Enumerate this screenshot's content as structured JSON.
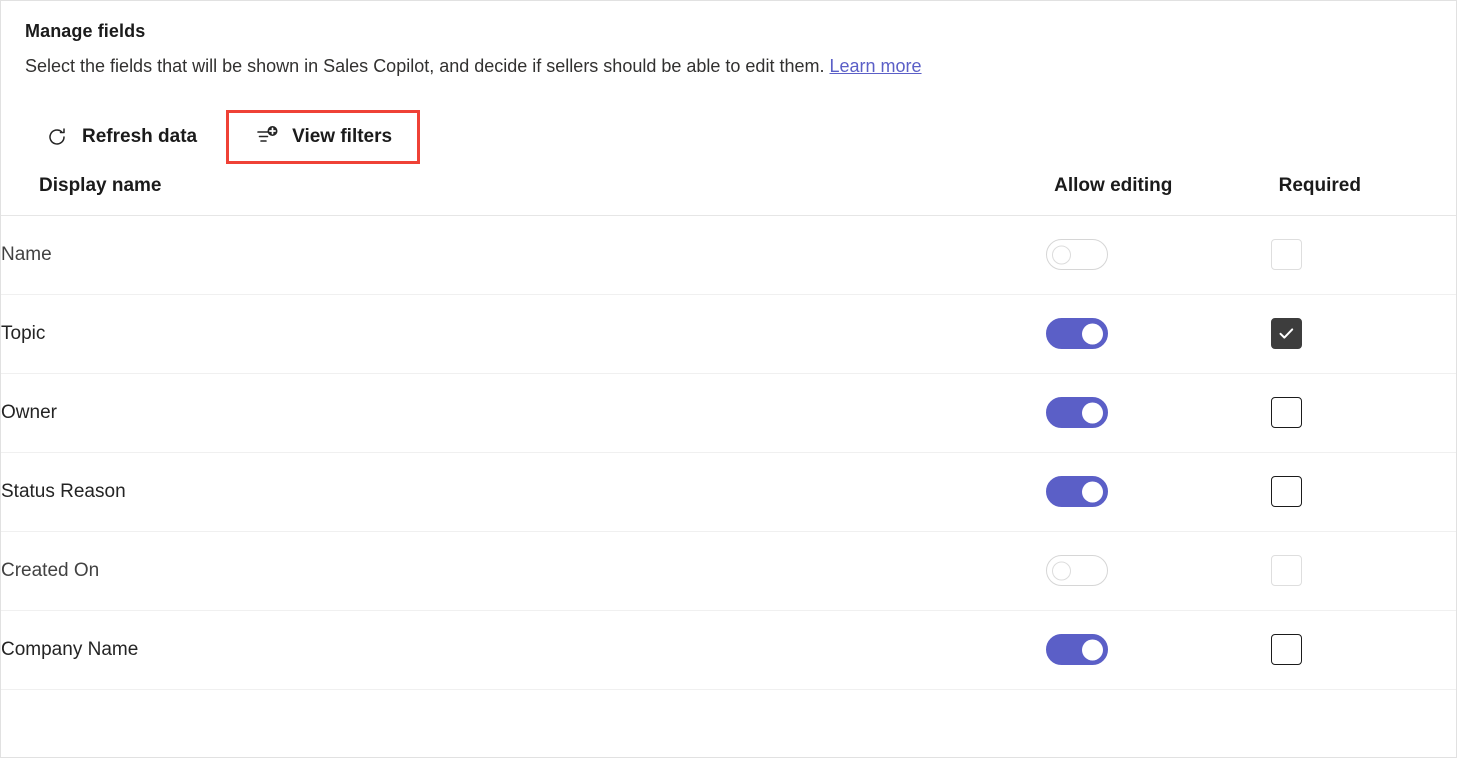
{
  "header": {
    "title": "Manage fields",
    "subtitle_text": "Select the fields that will be shown in Sales Copilot, and decide if sellers should be able to edit them.",
    "link_label": "Learn more",
    "link_color": "#5b5fc7"
  },
  "command_bar": {
    "buttons": [
      {
        "label": "Refresh data",
        "icon": "refresh-icon",
        "highlighted": false
      },
      {
        "label": "View filters",
        "icon": "filter-add-icon",
        "highlighted": true
      }
    ],
    "highlight_color": "#ef4136"
  },
  "table": {
    "columns": [
      {
        "key": "display_name",
        "label": "Display name"
      },
      {
        "key": "allow_editing",
        "label": "Allow editing"
      },
      {
        "key": "required",
        "label": "Required"
      }
    ],
    "rows": [
      {
        "display_name": "Name",
        "allow_editing": "off",
        "allow_editing_disabled": true,
        "required": "unchecked",
        "required_disabled": true
      },
      {
        "display_name": "Topic",
        "allow_editing": "on",
        "allow_editing_disabled": false,
        "required": "checked",
        "required_disabled": false
      },
      {
        "display_name": "Owner",
        "allow_editing": "on",
        "allow_editing_disabled": false,
        "required": "unchecked",
        "required_disabled": false
      },
      {
        "display_name": "Status Reason",
        "allow_editing": "on",
        "allow_editing_disabled": false,
        "required": "unchecked",
        "required_disabled": false
      },
      {
        "display_name": "Created On",
        "allow_editing": "off",
        "allow_editing_disabled": true,
        "required": "unchecked",
        "required_disabled": true
      },
      {
        "display_name": "Company Name",
        "allow_editing": "on",
        "allow_editing_disabled": false,
        "required": "unchecked",
        "required_disabled": false
      }
    ]
  },
  "colors": {
    "toggle_on": "#5b5fc7",
    "checkbox_checked": "#3d3d3d",
    "text_primary": "#242424",
    "divider": "#f0f0f0"
  }
}
